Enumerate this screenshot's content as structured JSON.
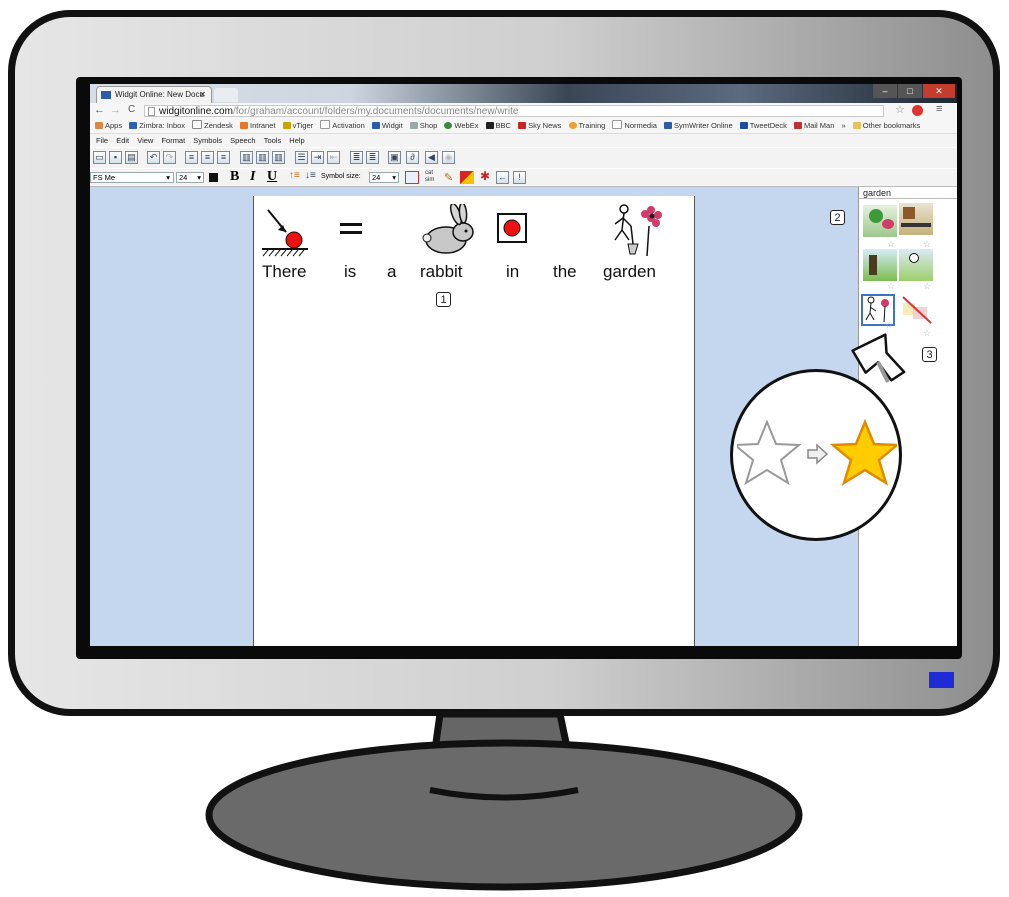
{
  "browser": {
    "tab_title": "Widgit Online: New Docu",
    "url_domain": "widgitonline.com",
    "url_path": "/for/graham/account/folders/my.documents/documents/new/write",
    "bookmarks": [
      "Apps",
      "Zimbra: Inbox",
      "Zendesk",
      "Intranet",
      "vTiger",
      "Activation",
      "Widgit",
      "Shop",
      "WebEx",
      "BBC",
      "Sky News",
      "Training",
      "Normedia",
      "SymWriter Online",
      "TweetDeck",
      "Mail Man",
      "»",
      "Other bookmarks"
    ]
  },
  "menu": {
    "file": "File",
    "edit": "Edit",
    "view": "View",
    "format": "Format",
    "symbols": "Symbols",
    "speech": "Speech",
    "tools": "Tools",
    "help": "Help"
  },
  "format_bar": {
    "font": "FS Me",
    "size": "24",
    "bold": "B",
    "italic": "I",
    "underline": "U",
    "symbol_size_label": "Symbol size:",
    "symbol_size_value": "24",
    "cat_sim": "cat sim"
  },
  "document": {
    "words": [
      "There",
      "is",
      "a",
      "rabbit",
      "in",
      "the",
      "garden"
    ]
  },
  "panel": {
    "search_word": "garden"
  },
  "callouts": {
    "one": "1",
    "two": "2",
    "three": "3"
  },
  "colors": {
    "page_bg": "#c4d7ee",
    "power_led": "#1e2bd6",
    "star_active": "#ffcc00"
  }
}
